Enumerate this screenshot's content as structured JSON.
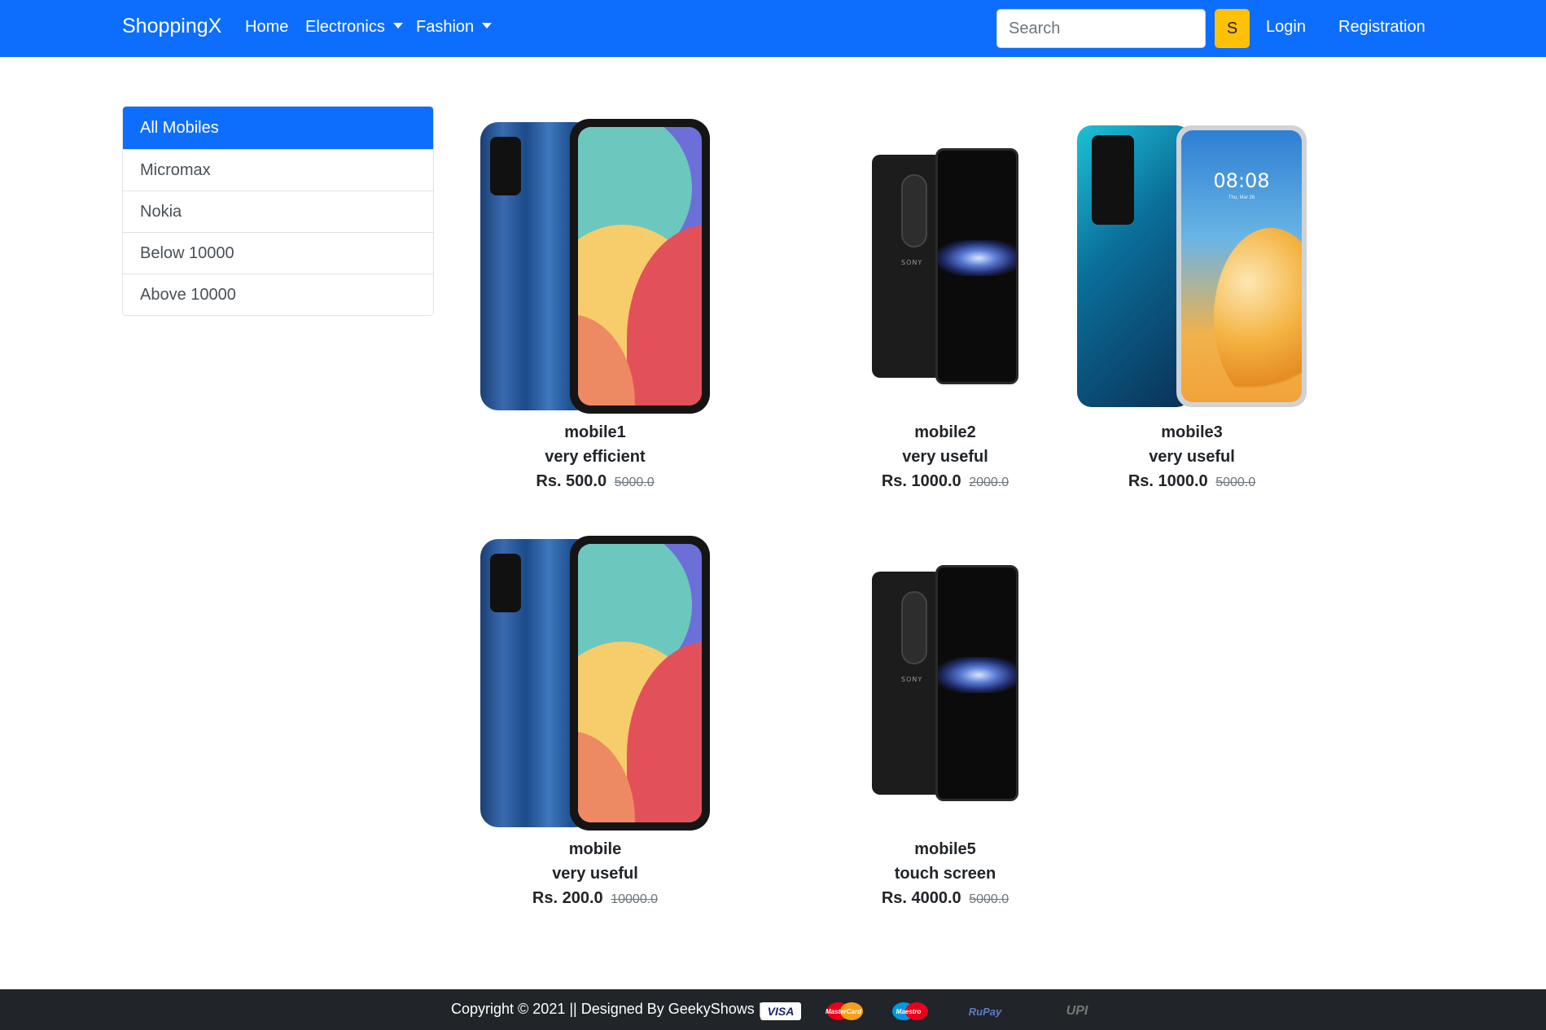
{
  "navbar": {
    "brand": "ShoppingX",
    "home": "Home",
    "electronics": "Electronics",
    "fashion": "Fashion",
    "search_placeholder": "Search",
    "search_button": "S",
    "login": "Login",
    "registration": "Registration"
  },
  "sidebar": {
    "items": [
      {
        "label": "All Mobiles",
        "active": true
      },
      {
        "label": "Micromax"
      },
      {
        "label": "Nokia"
      },
      {
        "label": "Below 10000"
      },
      {
        "label": "Above 10000"
      }
    ]
  },
  "products": [
    {
      "name": "mobile1",
      "desc": "very efficient",
      "price": "Rs. 500.0",
      "old_price": "5000.0",
      "image": "alcatel-blue-phone"
    },
    {
      "name": "mobile2",
      "desc": "very useful",
      "price": "Rs. 1000.0",
      "old_price": "2000.0",
      "image": "sony-black-phone"
    },
    {
      "name": "mobile3",
      "desc": "very useful",
      "price": "Rs. 1000.0",
      "old_price": "5000.0",
      "image": "huawei-blue-phone"
    },
    {
      "name": "mobile",
      "desc": "very useful",
      "price": "Rs. 200.0",
      "old_price": "10000.0",
      "image": "alcatel-blue-phone"
    },
    {
      "name": "mobile5",
      "desc": "touch screen",
      "price": "Rs. 4000.0",
      "old_price": "5000.0",
      "image": "sony-black-phone"
    }
  ],
  "phone_art": {
    "sony_logo": "SONY",
    "huawei_time": "08:08",
    "huawei_date": "Thu, Mar 26"
  },
  "footer": {
    "text": "Copyright © 2021 || Designed By GeekyShows ||",
    "payments": [
      "VISA",
      "MasterCard",
      "Maestro",
      "RuPay",
      "UPI"
    ]
  },
  "colors": {
    "primary": "#0d6efd",
    "warning": "#ffc107",
    "footer": "#212529"
  }
}
